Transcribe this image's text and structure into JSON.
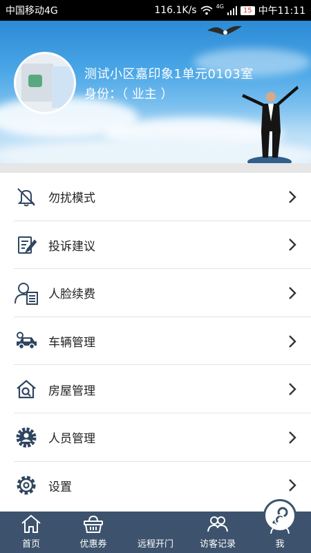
{
  "status_bar": {
    "carrier": "中国移动4G",
    "speed": "116.1K/s",
    "network": "4G",
    "battery": "15",
    "time": "中午11:11"
  },
  "profile": {
    "address": "测试小区嘉印象1单元0103室",
    "role": "身份：（ 业主 ）"
  },
  "menu": [
    {
      "label": "勿扰模式",
      "icon": "bell-off-icon"
    },
    {
      "label": "投诉建议",
      "icon": "complaint-edit-icon"
    },
    {
      "label": "人脸续费",
      "icon": "face-renew-icon"
    },
    {
      "label": "车辆管理",
      "icon": "car-gear-icon"
    },
    {
      "label": "房屋管理",
      "icon": "house-search-icon"
    },
    {
      "label": "人员管理",
      "icon": "person-gear-icon"
    },
    {
      "label": "设置",
      "icon": "settings-icon"
    }
  ],
  "tabbar": [
    {
      "label": "首页",
      "icon": "home-icon"
    },
    {
      "label": "优惠券",
      "icon": "basket-icon"
    },
    {
      "label": "远程开门",
      "icon": "key-icon"
    },
    {
      "label": "访客记录",
      "icon": "visitors-icon"
    },
    {
      "label": "我",
      "icon": "user-icon"
    }
  ],
  "colors": {
    "tabbar_bg": "#3d536d",
    "icon_color": "#2f4560",
    "sky_top": "#2c8bd6"
  }
}
